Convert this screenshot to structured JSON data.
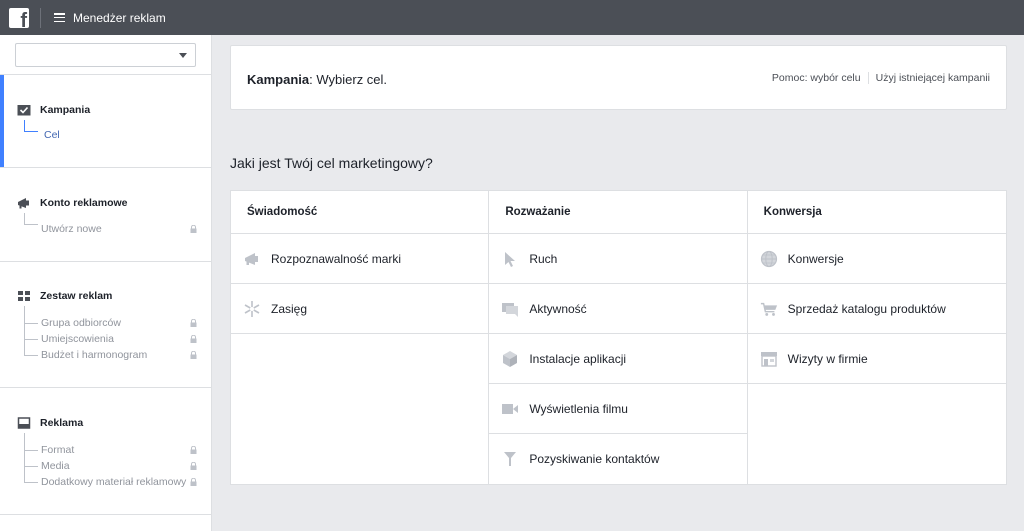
{
  "topbar": {
    "app_title": "Menedżer reklam",
    "logo_letter": "f"
  },
  "sidebar": {
    "account_select_value": "",
    "sections": [
      {
        "title": "Kampania",
        "icon": "checkbox-icon",
        "items": [
          {
            "label": "Cel",
            "locked": false,
            "active": true
          }
        ]
      },
      {
        "title": "Konto reklamowe",
        "icon": "megaphone-icon",
        "items": [
          {
            "label": "Utwórz nowe",
            "locked": true
          }
        ]
      },
      {
        "title": "Zestaw reklam",
        "icon": "grid-icon",
        "items": [
          {
            "label": "Grupa odbiorców",
            "locked": true
          },
          {
            "label": "Umiejscowienia",
            "locked": true
          },
          {
            "label": "Budżet i harmonogram",
            "locked": true
          }
        ]
      },
      {
        "title": "Reklama",
        "icon": "ad-icon",
        "items": [
          {
            "label": "Format",
            "locked": true
          },
          {
            "label": "Media",
            "locked": true
          },
          {
            "label": "Dodatkowy materiał reklamowy",
            "locked": true
          }
        ]
      }
    ]
  },
  "header": {
    "title_bold": "Kampania",
    "title_rest": ": Wybierz cel.",
    "link_help": "Pomoc: wybór celu",
    "link_existing": "Użyj istniejącej kampanii"
  },
  "question": "Jaki jest Twój cel marketingowy?",
  "columns": [
    {
      "heading": "Świadomość",
      "options": [
        {
          "label": "Rozpoznawalność marki",
          "icon": "megaphone-icon"
        },
        {
          "label": "Zasięg",
          "icon": "snowflake-icon"
        }
      ]
    },
    {
      "heading": "Rozważanie",
      "options": [
        {
          "label": "Ruch",
          "icon": "cursor-icon"
        },
        {
          "label": "Aktywność",
          "icon": "chat-icon"
        },
        {
          "label": "Instalacje aplikacji",
          "icon": "cube-icon"
        },
        {
          "label": "Wyświetlenia filmu",
          "icon": "video-icon"
        },
        {
          "label": "Pozyskiwanie kontaktów",
          "icon": "funnel-icon"
        }
      ]
    },
    {
      "heading": "Konwersja",
      "options": [
        {
          "label": "Konwersje",
          "icon": "globe-icon"
        },
        {
          "label": "Sprzedaż katalogu produktów",
          "icon": "cart-icon"
        },
        {
          "label": "Wizyty w firmie",
          "icon": "store-icon"
        }
      ]
    }
  ],
  "colors": {
    "topbar": "#4b4f56",
    "accent": "#4080ff",
    "link": "#4267b2",
    "icon_gray": "#bec2c9"
  }
}
